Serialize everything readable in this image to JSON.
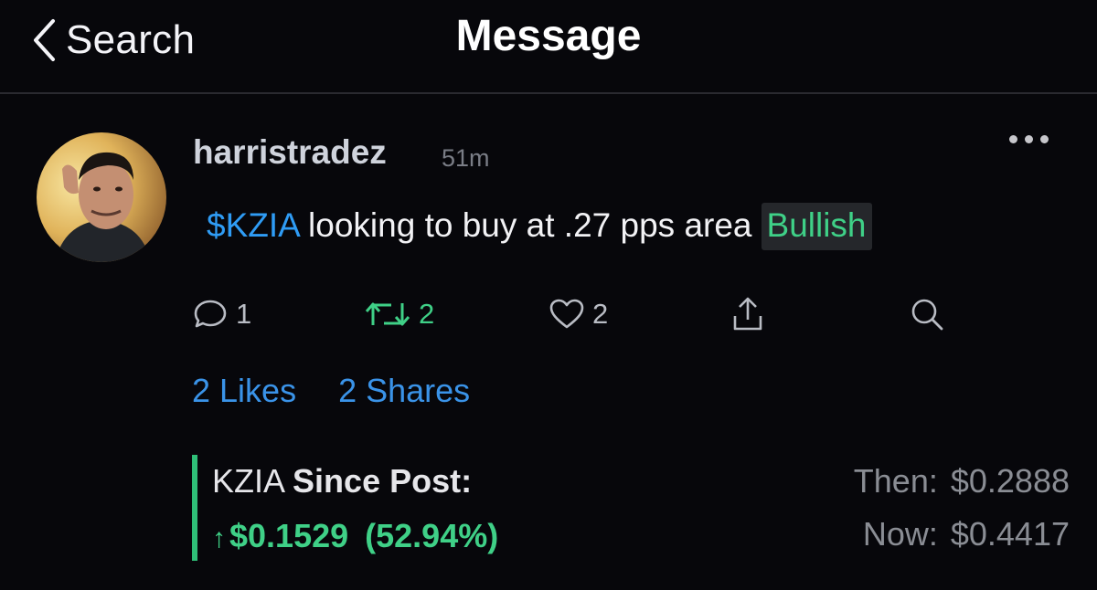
{
  "nav": {
    "back_label": "Search",
    "title": "Message"
  },
  "post": {
    "username": "harristradez",
    "time": "51m",
    "cashtag": "$KZIA",
    "text": " looking to buy at .27 pps area",
    "sentiment": "Bullish"
  },
  "actions": {
    "replies": "1",
    "reshares": "2",
    "likes": "2"
  },
  "engagement": {
    "likes_link": "2 Likes",
    "shares_link": "2 Shares"
  },
  "performance": {
    "ticker": "KZIA",
    "since_label": "Since Post:",
    "change_arrow": "↑",
    "change_amount": "$0.1529",
    "change_percent": "(52.94%)",
    "then_label": "Then:",
    "then_value": "$0.2888",
    "now_label": "Now:",
    "now_value": "$0.4417"
  },
  "colors": {
    "accent_blue": "#2f9cf5",
    "bullish_green": "#3fd087",
    "background": "#07070b"
  }
}
